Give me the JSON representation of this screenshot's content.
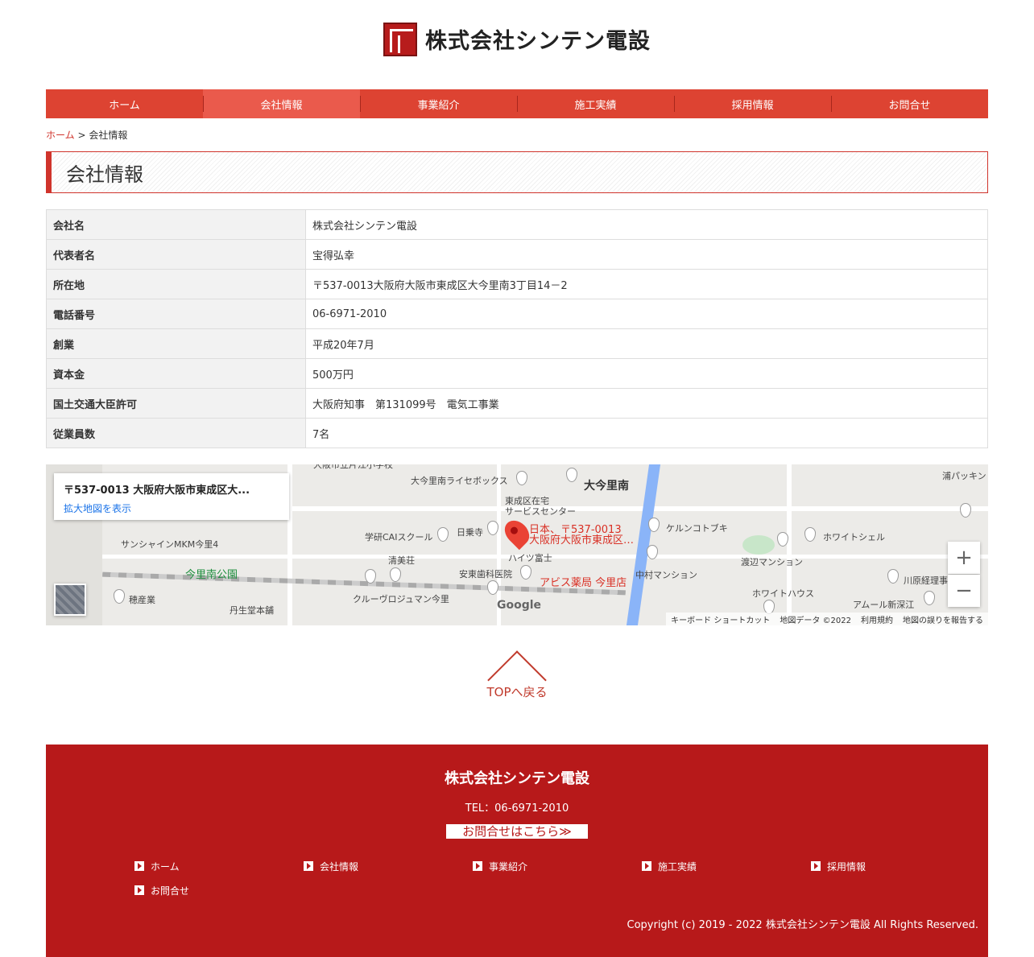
{
  "header": {
    "logo_text": "株式会社シンテン電設"
  },
  "nav": [
    {
      "label": "ホーム"
    },
    {
      "label": "会社情報"
    },
    {
      "label": "事業紹介"
    },
    {
      "label": "施工実績"
    },
    {
      "label": "採用情報"
    },
    {
      "label": "お問合せ"
    }
  ],
  "breadcrumb": {
    "home": "ホーム",
    "separator": " > ",
    "current": "会社情報"
  },
  "page_title": "会社情報",
  "company_table": [
    {
      "label": "会社名",
      "value": "株式会社シンテン電設"
    },
    {
      "label": "代表者名",
      "value": "宝得弘幸"
    },
    {
      "label": "所在地",
      "value": "〒537-0013大阪府大阪市東成区大今里南3丁目14－2"
    },
    {
      "label": "電話番号",
      "value": "06-6971-2010"
    },
    {
      "label": "創業",
      "value": "平成20年7月"
    },
    {
      "label": "資本金",
      "value": "500万円"
    },
    {
      "label": "国土交通大臣許可",
      "value": "大阪府知事　第131099号　電気工事業"
    },
    {
      "label": "従業員数",
      "value": "7名"
    }
  ],
  "map": {
    "card_address": "〒537-0013 大阪府大阪市東成区大...",
    "card_link": "拡大地図を表示",
    "marker_line1": "日本、〒537-0013",
    "marker_line2": "大阪府大阪市東成区…",
    "labels": {
      "area": "大今里南",
      "school": "大阪市立片江小学校",
      "license": "大今里南ライセボックス",
      "service": "東成区在宅",
      "service2": "サービスセンター",
      "kelun": "ケルンコトブキ",
      "white_shell": "ホワイトシェル",
      "gakken": "学研CAIスクール",
      "nichijo": "日乗寺",
      "sunshine": "サンシャインMKM今里4",
      "seibisou": "清美荘",
      "heights": "ハイツ富士",
      "watanabe": "渡辺マンション",
      "park": "今里南公園",
      "dental": "安東歯科医院",
      "nakamura": "中村マンション",
      "kawahara": "川原経理事",
      "white_house": "ホワイトハウス",
      "hozan": "穂産業",
      "tansei": "丹生堂本舗",
      "cruvio": "クルーヴロジュマン今里",
      "amour": "アムール新深江",
      "ura": "浦パッキン",
      "pharmacy": "アビス薬局 今里店"
    },
    "google": "Google",
    "footer": {
      "shortcuts": "キーボード ショートカット",
      "data": "地図データ ©2022",
      "terms": "利用規約",
      "report": "地図の誤りを報告する"
    },
    "zoom_in": "+",
    "zoom_out": "−"
  },
  "totop": {
    "label": "TOPへ戻る"
  },
  "footer": {
    "company": "株式会社シンテン電設",
    "tel": "TEL：06-6971-2010",
    "contact": "お問合せはこちら≫",
    "nav": [
      {
        "label": "ホーム"
      },
      {
        "label": "会社情報"
      },
      {
        "label": "事業紹介"
      },
      {
        "label": "施工実績"
      },
      {
        "label": "採用情報"
      },
      {
        "label": "お問合せ"
      }
    ],
    "copyright": "Copyright (c) 2019 - 2022 株式会社シンテン電設 All Rights Reserved."
  },
  "colors": {
    "brand_red": "#dd4332",
    "footer_red": "#b7191a",
    "nav_active": "#ea5a4c"
  }
}
